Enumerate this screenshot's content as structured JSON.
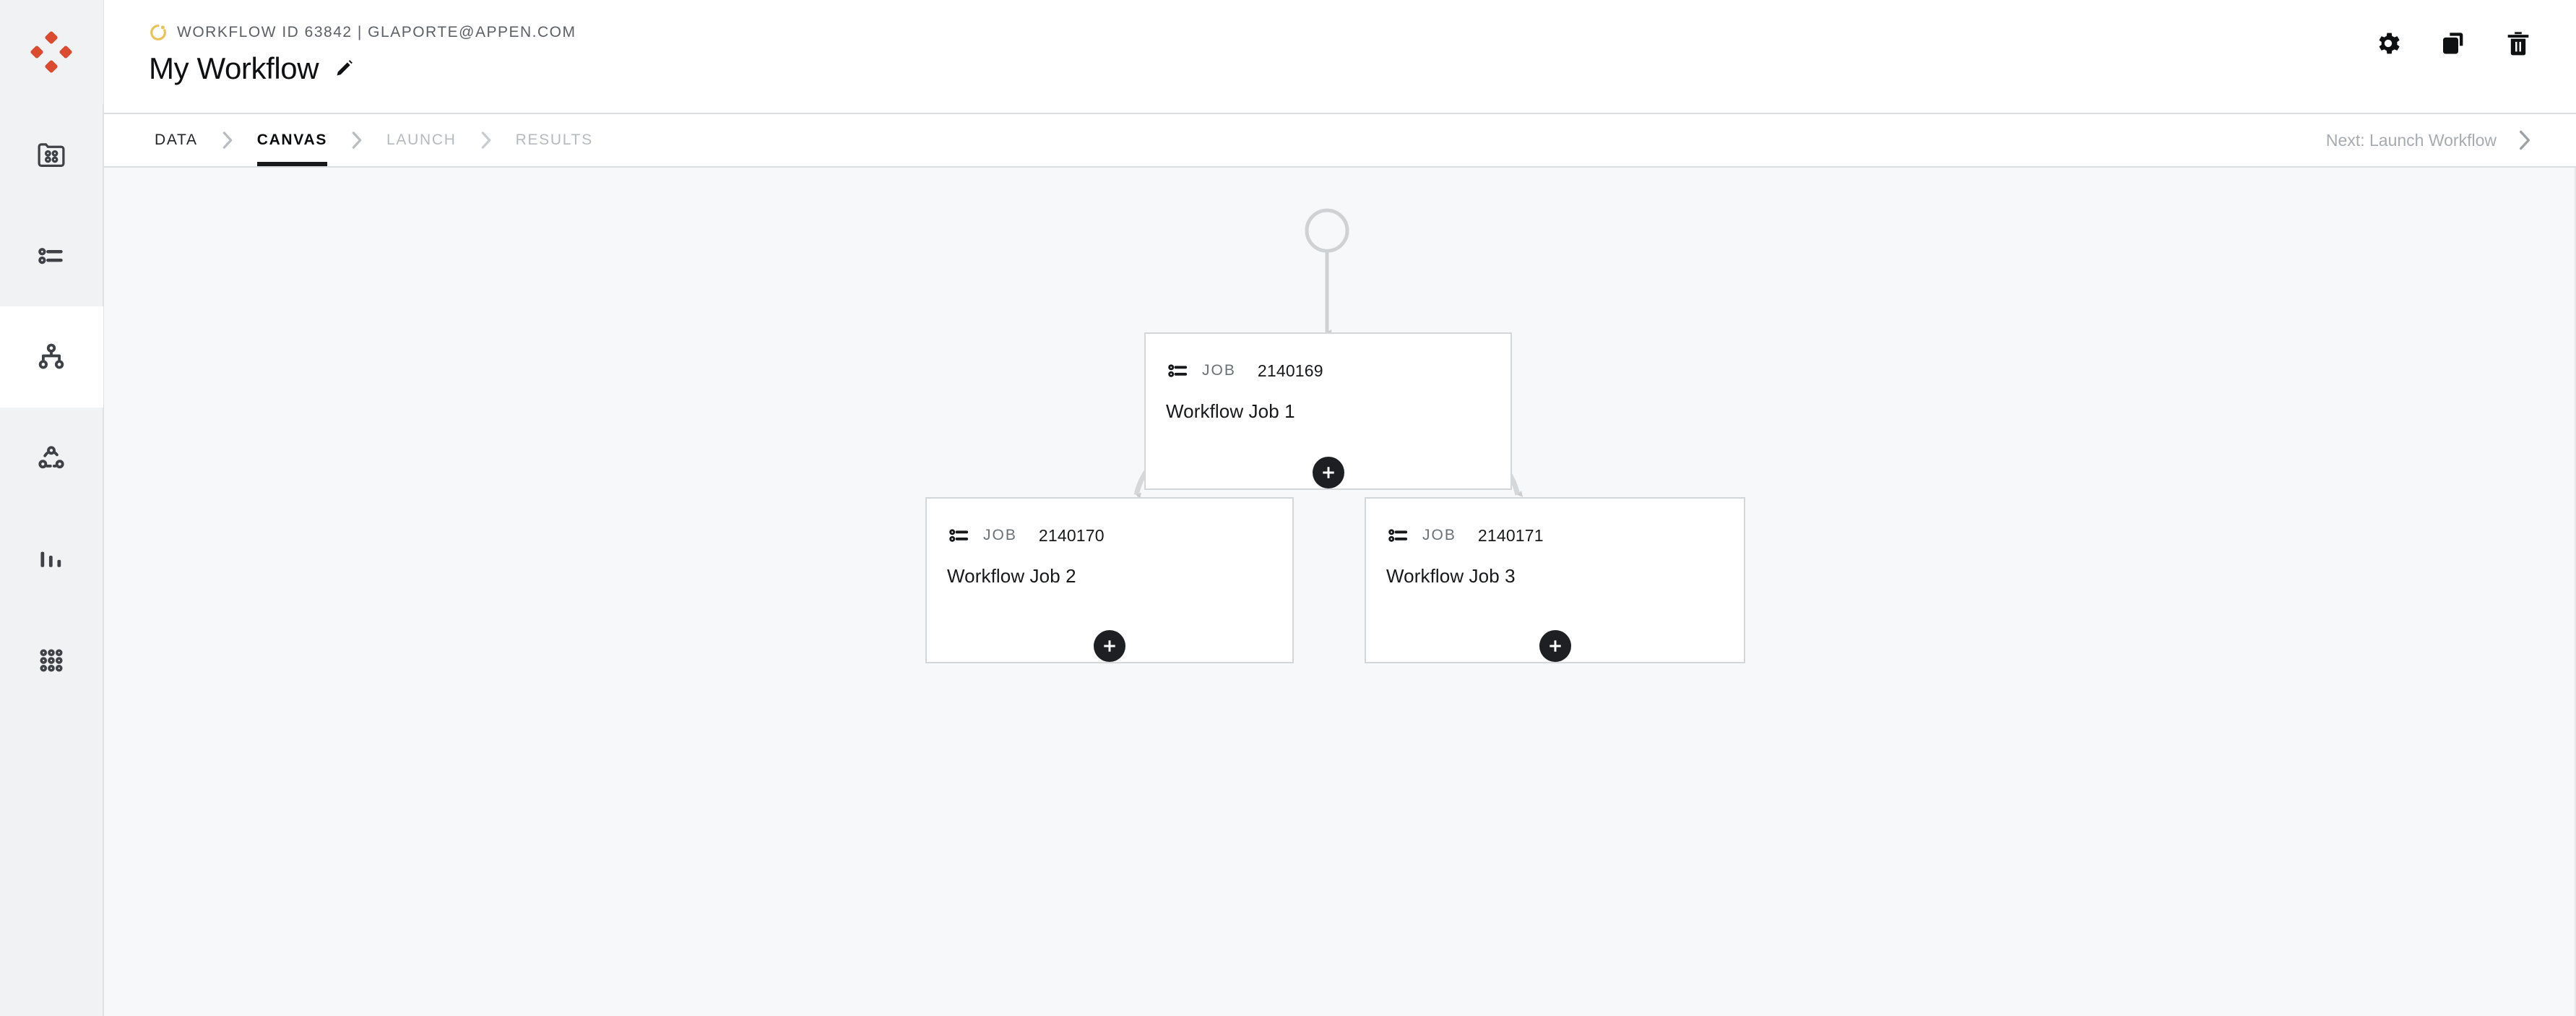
{
  "brand": {
    "logo_icon": "appen-diamond-logo",
    "logo_color": "#db4b30"
  },
  "sidebar": {
    "items": [
      {
        "icon": "data-folder-icon",
        "name": "data",
        "active": false
      },
      {
        "icon": "jobs-list-icon",
        "name": "jobs",
        "active": false
      },
      {
        "icon": "workflow-tree-icon",
        "name": "workflows",
        "active": true
      },
      {
        "icon": "dashed-circle-nodes-icon",
        "name": "pipelines",
        "active": false
      },
      {
        "icon": "bar-chart-icon",
        "name": "reports",
        "active": false
      },
      {
        "icon": "grid-dots-icon",
        "name": "apps",
        "active": false
      }
    ]
  },
  "header": {
    "status_icon": "spinner-status-icon",
    "status_color": "#e8c252",
    "meta": "WORKFLOW ID 63842 | GLAPORTE@APPEN.COM",
    "title": "My Workflow",
    "edit_icon": "pencil-icon",
    "actions": [
      {
        "icon": "gear-icon",
        "label": "Settings"
      },
      {
        "icon": "copy-icon",
        "label": "Duplicate"
      },
      {
        "icon": "trash-icon",
        "label": "Delete"
      }
    ]
  },
  "stepbar": {
    "steps": [
      {
        "label": "DATA",
        "state": "done"
      },
      {
        "label": "CANVAS",
        "state": "current"
      },
      {
        "label": "LAUNCH",
        "state": "todo"
      },
      {
        "label": "RESULTS",
        "state": "todo"
      }
    ],
    "separator_icon": "chevron-right-icon",
    "next_label": "Next: Launch Workflow",
    "next_icon": "chevron-right-icon"
  },
  "canvas": {
    "start_node_icon": "start-circle-node",
    "add_icon": "plus-icon",
    "nodes": [
      {
        "kind": "JOB",
        "id": "2140169",
        "name": "Workflow Job 1",
        "icon": "job-list-icon",
        "add_label": "Add step"
      },
      {
        "kind": "JOB",
        "id": "2140170",
        "name": "Workflow Job 2",
        "icon": "job-list-icon",
        "add_label": "Add step"
      },
      {
        "kind": "JOB",
        "id": "2140171",
        "name": "Workflow Job 3",
        "icon": "job-list-icon",
        "add_label": "Add step"
      }
    ]
  },
  "colors": {
    "brand": "#db4b30",
    "status": "#e8c252",
    "canvas_bg": "#f7f8f9",
    "rail_bg": "#f1f2f4",
    "node_border": "#d4d7da",
    "connector": "#d3d6d8",
    "accent_dark": "#1d1f22"
  }
}
